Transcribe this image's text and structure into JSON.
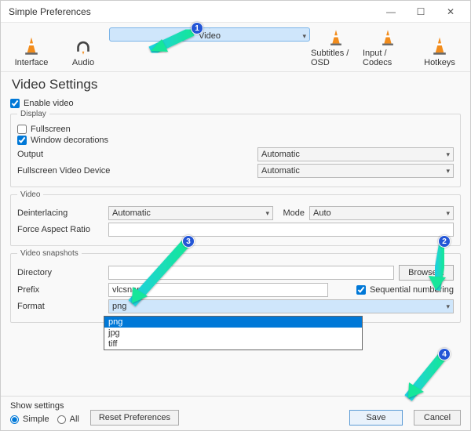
{
  "window": {
    "title": "Simple Preferences"
  },
  "tabs": {
    "interface": "Interface",
    "audio": "Audio",
    "video": "Video",
    "subtitles": "Subtitles / OSD",
    "input": "Input / Codecs",
    "hotkeys": "Hotkeys"
  },
  "heading": "Video Settings",
  "enable_video": "Enable video",
  "display": {
    "legend": "Display",
    "fullscreen": "Fullscreen",
    "window_decorations": "Window decorations",
    "output_label": "Output",
    "output_value": "Automatic",
    "fsdev_label": "Fullscreen Video Device",
    "fsdev_value": "Automatic"
  },
  "video": {
    "legend": "Video",
    "deint_label": "Deinterlacing",
    "deint_value": "Automatic",
    "mode_label": "Mode",
    "mode_value": "Auto",
    "far_label": "Force Aspect Ratio"
  },
  "snap": {
    "legend": "Video snapshots",
    "dir_label": "Directory",
    "browse": "Browse...",
    "prefix_label": "Prefix",
    "prefix_value": "vlcsnap-",
    "seq": "Sequential numbering",
    "format_label": "Format",
    "format_value": "png",
    "opts": {
      "o1": "png",
      "o2": "jpg",
      "o3": "tiff"
    }
  },
  "footer": {
    "show_settings": "Show settings",
    "simple": "Simple",
    "all": "All",
    "reset": "Reset Preferences",
    "save": "Save",
    "cancel": "Cancel"
  }
}
